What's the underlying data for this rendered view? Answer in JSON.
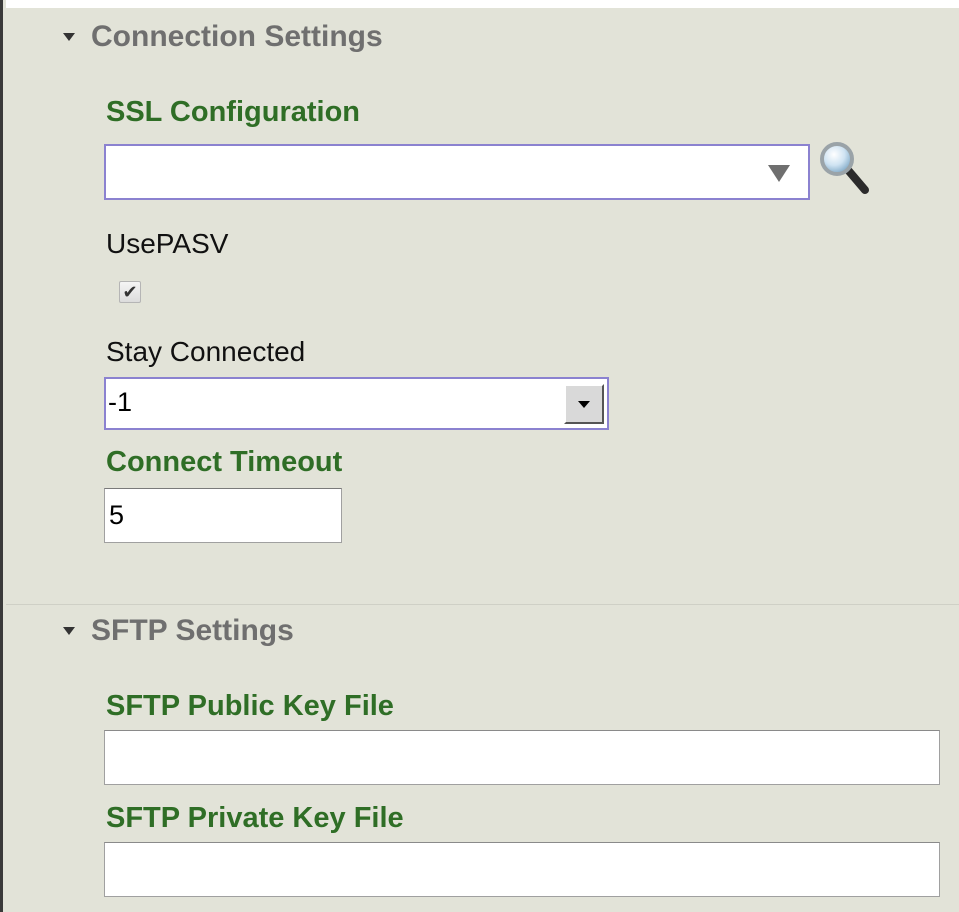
{
  "connection_settings": {
    "header": "Connection Settings",
    "ssl_configuration": {
      "label": "SSL Configuration",
      "value": ""
    },
    "use_pasv": {
      "label": "UsePASV",
      "checked": true,
      "check_glyph": "✔"
    },
    "stay_connected": {
      "label": "Stay Connected",
      "value": "-1"
    },
    "connect_timeout": {
      "label": "Connect Timeout",
      "value": "5"
    }
  },
  "sftp_settings": {
    "header": "SFTP Settings",
    "public_key_file": {
      "label": "SFTP Public Key File",
      "value": ""
    },
    "private_key_file": {
      "label": "SFTP Private Key File",
      "value": ""
    }
  },
  "icons": {
    "section_toggle": "caret-down-icon",
    "lookup": "magnifier-icon",
    "dropdown": "dropdown-arrow-icon"
  },
  "colors": {
    "panel_background": "#e2e3d8",
    "label_green": "#2f6e26",
    "header_gray": "#6f6f6f",
    "focus_border": "#8b82d0"
  }
}
